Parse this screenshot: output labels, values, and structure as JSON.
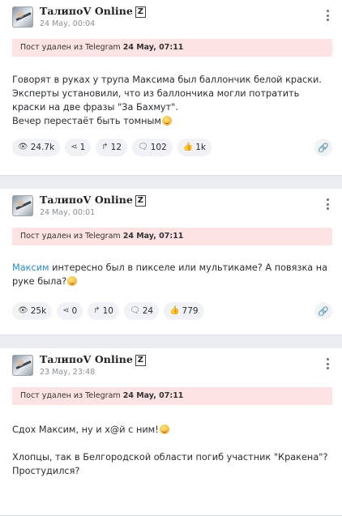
{
  "posts": [
    {
      "author": "ТалипоV Online",
      "badge": "Z",
      "date": "24 May, 00:04",
      "deleted_prefix": "Пост удален из Telegram",
      "deleted_date": "24 May, 07:11",
      "text_lines": [
        "Говорят в руках у трупа Максима был баллончик белой краски.",
        "Эксперты установили, что из баллончика могли потратить краски на две фразы \"За Бахмут\".",
        "Вечер перестаёт быть томным"
      ],
      "stats": {
        "views": "24.7k",
        "shares": "1",
        "forwards": "12",
        "comments": "102",
        "likes": "1k"
      }
    },
    {
      "author": "ТалипоV Online",
      "badge": "Z",
      "date": "24 May, 00:01",
      "deleted_prefix": "Пост удален из Telegram",
      "deleted_date": "24 May, 07:11",
      "mention": "Максим",
      "text_rest": " интересно был в пикселе или мультикаме? А повязка на руке была?",
      "stats": {
        "views": "25k",
        "shares": "0",
        "forwards": "10",
        "comments": "24",
        "likes": "779"
      }
    },
    {
      "author": "ТалипоV Online",
      "badge": "Z",
      "date": "23 May, 23:48",
      "deleted_prefix": "Пост удален из Telegram",
      "deleted_date": "24 May, 07:11",
      "text_p1": "Сдох Максим, ну и х@й с ним!",
      "text_p2": "Хлопцы, так в Белгородской области погиб участник \"Кракена\"? Простудился?"
    }
  ],
  "icons": {
    "views": "eye-icon",
    "shares": "share-icon",
    "forwards": "forward-icon",
    "comments": "comments-icon",
    "likes": "thumbs-up-icon",
    "link": "link-icon",
    "menu": "more-vertical-icon"
  },
  "colors": {
    "deleted_bg": "#fde3e3",
    "mention": "#2a8bc7",
    "page_bg": "#ebedf0"
  }
}
